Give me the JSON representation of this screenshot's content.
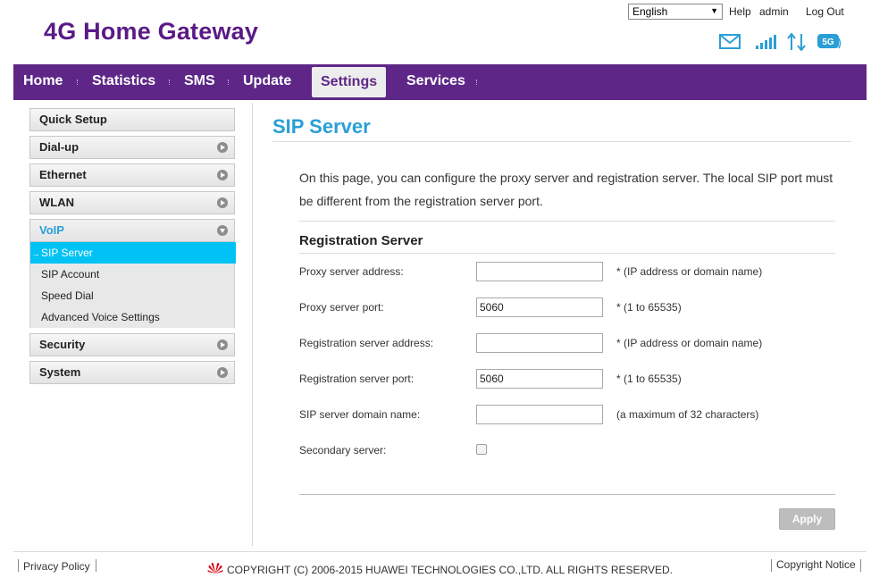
{
  "header": {
    "brand": "4G Home Gateway",
    "language": "English",
    "help": "Help",
    "user": "admin",
    "logout": "Log Out",
    "icons": [
      "mail-icon",
      "signal-icon",
      "data-transfer-icon",
      "5g-icon"
    ]
  },
  "nav": {
    "items": [
      "Home",
      "Statistics",
      "SMS",
      "Update",
      "Settings",
      "Services"
    ],
    "active": "Settings"
  },
  "sidebar": {
    "items": [
      {
        "label": "Quick Setup"
      },
      {
        "label": "Dial-up"
      },
      {
        "label": "Ethernet"
      },
      {
        "label": "WLAN"
      },
      {
        "label": "VoIP"
      },
      {
        "label": "Security"
      },
      {
        "label": "System"
      }
    ],
    "voip_submenu": [
      "SIP Server",
      "SIP Account",
      "Speed Dial",
      "Advanced Voice Settings"
    ],
    "active_sub": "SIP Server"
  },
  "content": {
    "title": "SIP Server",
    "intro": "On this page, you can configure the proxy server and registration server. The local SIP port must be different from the registration server port.",
    "section_title": "Registration Server",
    "fields": [
      {
        "label": "Proxy server address:",
        "value": "",
        "hint": "* (IP address or domain name)"
      },
      {
        "label": "Proxy server port:",
        "value": "5060",
        "hint": "* (1 to 65535)"
      },
      {
        "label": "Registration server address:",
        "value": "",
        "hint": "* (IP address or domain name)"
      },
      {
        "label": "Registration server port:",
        "value": "5060",
        "hint": "* (1 to 65535)"
      },
      {
        "label": "SIP server domain name:",
        "value": "",
        "hint": "(a maximum of 32 characters)"
      }
    ],
    "secondary_label": "Secondary server:",
    "secondary_checked": false,
    "apply": "Apply"
  },
  "footer": {
    "privacy": "Privacy Policy",
    "copyright": "COPYRIGHT (C) 2006-2015 HUAWEI TECHNOLOGIES CO.,LTD. ALL RIGHTS RESERVED.",
    "notice": "Copyright Notice"
  },
  "colors": {
    "brand": "#5a1a86",
    "navbar": "#5e2787",
    "accent": "#2a9fd6",
    "active_sub": "#00c2f4"
  }
}
